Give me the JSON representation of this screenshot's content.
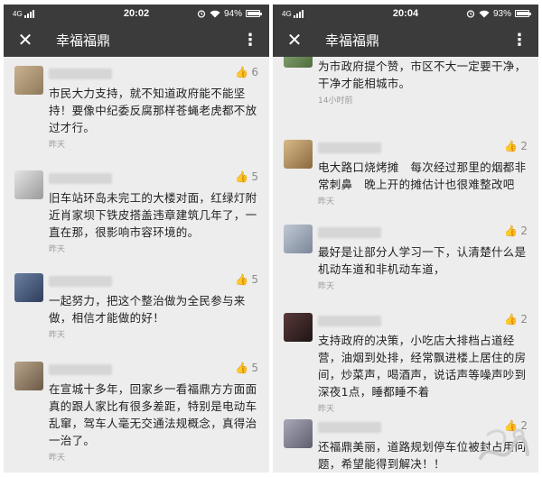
{
  "status_left": {
    "network": "4G",
    "time": "20:02",
    "battery": "94%",
    "battery_level": 0.94
  },
  "status_right": {
    "network": "4G",
    "time": "20:04",
    "battery": "93%",
    "battery_level": 0.93
  },
  "app_title": "幸福福鼎",
  "left_comments": [
    {
      "likes": "6",
      "text": "市民大力支持，就不知道政府能不能坚持！要像中纪委反腐那样苍蝇老虎都不放过才行。",
      "time": "昨天"
    },
    {
      "likes": "5",
      "text": "旧车站环岛未完工的大楼对面，红绿灯附近肖家坝下铁皮搭盖违章建筑几年了，一直在那，很影响市容环境的。",
      "time": "昨天"
    },
    {
      "likes": "5",
      "text": "一起努力，把这个整治做为全民参与来做，相信才能做的好！",
      "time": "昨天"
    },
    {
      "likes": "5",
      "text": "在宣城十多年，回家乡一看福鼎方方面面真的跟人家比有很多差距，特别是电动车乱窜，驾车人毫无交通法规概念，真得治一治了。",
      "time": "昨天"
    }
  ],
  "right_comments": [
    {
      "likes": "",
      "text": "为市政府提个赞，市区不大一定要干净，干净才能相城市。",
      "time": "14小时前"
    },
    {
      "likes": "2",
      "text": "电大路口烧烤摊　每次经过那里的烟都非常刺鼻　晚上开的摊估计也很难整改吧",
      "time": "昨天"
    },
    {
      "likes": "2",
      "text": "最好是让部分人学习一下，认清楚什么是机动车道和非机动车道，",
      "time": "昨天"
    },
    {
      "likes": "2",
      "text": "支持政府的决策，小吃店大排档占道经营，油烟到处排，经常飘进楼上居住的房间，炒菜声，喝酒声，说话声等噪声吵到深夜1点，睡都睡不着",
      "time": "昨天"
    },
    {
      "likes": "2",
      "text": "还福鼎美丽，道路规划停车位被封占用问题，希望能得到解决！！",
      "time": ""
    }
  ],
  "icons": {
    "close": "close-icon",
    "more": "more-vert-icon",
    "like": "thumb-up-icon",
    "wifi": "wifi-icon",
    "alarm": "alarm-icon"
  },
  "colors": {
    "bar": "#3b3b3b",
    "background": "#ededed",
    "text": "#222222",
    "muted": "#9a9a9a"
  }
}
